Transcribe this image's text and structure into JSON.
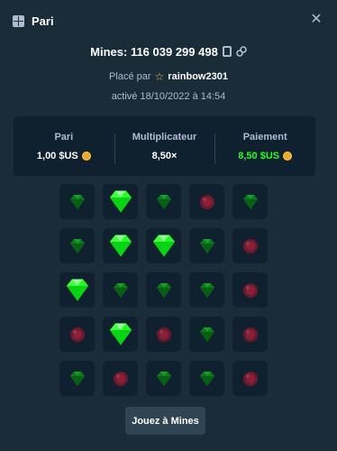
{
  "header": {
    "title": "Pari",
    "icon": "bet-slip-icon",
    "close_icon": "close-icon"
  },
  "mines_line": {
    "text": "Mines: 116 039 299 498",
    "copy_icon": "copy-icon",
    "link_icon": "link-icon"
  },
  "placed_by": {
    "prefix": "Placé par",
    "user_icon": "star-icon",
    "username": "rainbow2301"
  },
  "activated_text": "activé 18/10/2022 à 14:54",
  "stats": [
    {
      "label": "Pari",
      "value": "1,00 $US",
      "coin": true
    },
    {
      "label": "Multiplicateur",
      "value": "8,50×",
      "coin": false
    },
    {
      "label": "Paiement",
      "value": "8,50 $US",
      "coin": true
    }
  ],
  "board": {
    "rows": [
      [
        "gem-dim",
        "gem-bright",
        "gem-dim",
        "mine",
        "gem-dim"
      ],
      [
        "gem-dim",
        "gem-bright",
        "gem-bright",
        "gem-dim",
        "mine"
      ],
      [
        "gem-bright",
        "gem-dim",
        "gem-dim",
        "gem-dim",
        "mine"
      ],
      [
        "mine",
        "gem-bright",
        "mine",
        "gem-dim",
        "mine"
      ],
      [
        "gem-dim",
        "mine",
        "gem-dim",
        "gem-dim",
        "mine"
      ]
    ]
  },
  "play_button": {
    "label": "Jouez à Mines"
  },
  "colors": {
    "background": "#1a2c38",
    "panel": "#0f212e",
    "accent_green": "#1fff20",
    "muted": "#b1bad3"
  }
}
